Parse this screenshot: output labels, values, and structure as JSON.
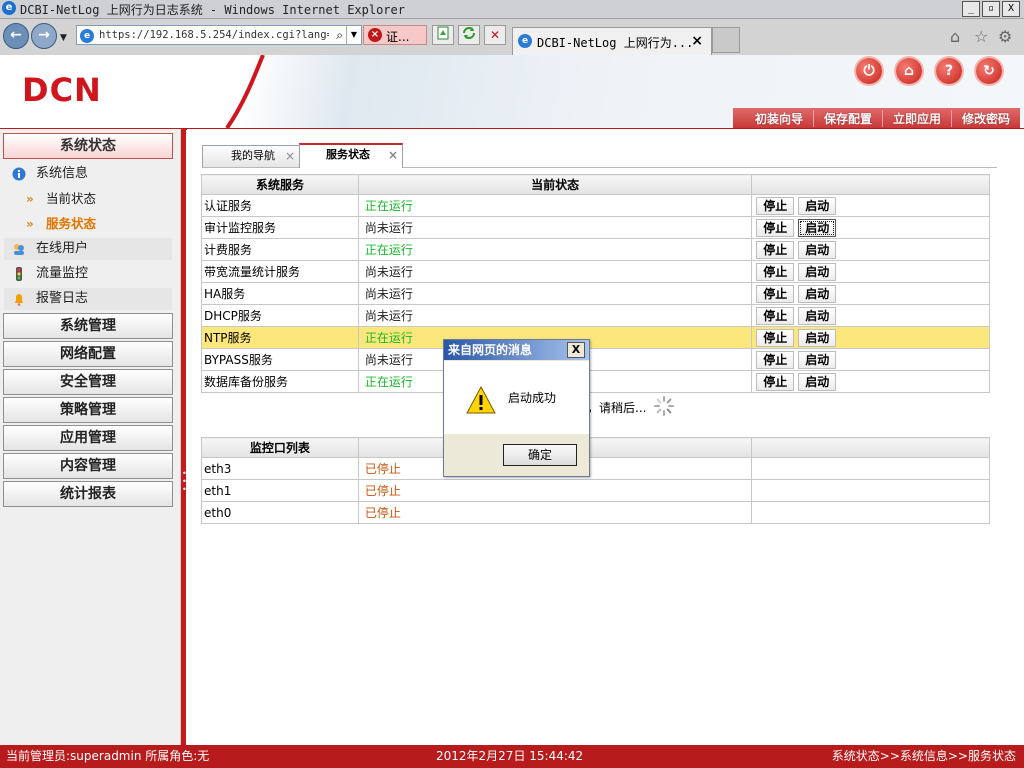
{
  "window": {
    "title": "DCBI-NetLog 上网行为日志系统 - Windows Internet Explorer",
    "min": "_",
    "max": "▫",
    "close": "X"
  },
  "browser": {
    "url": "https://192.168.5.254/index.cgi?lang=z",
    "cert_error_label": "证...",
    "tab_title": "DCBI-NetLog 上网行为...",
    "tab_close": "×"
  },
  "header": {
    "logo": "DCN",
    "menu": [
      "初装向导",
      "保存配置",
      "立即应用",
      "修改密码"
    ],
    "icons": [
      "power-icon",
      "home-icon",
      "help-icon",
      "refresh-icon"
    ]
  },
  "sidebar": {
    "status_section": "系统状态",
    "system_info": "系统信息",
    "sub_items": [
      {
        "label": "当前状态",
        "active": false
      },
      {
        "label": "服务状态",
        "active": true
      }
    ],
    "online_users": "在线用户",
    "traffic_monitor": "流量监控",
    "alarm_log": "报警日志",
    "sections": [
      "系统管理",
      "网络配置",
      "安全管理",
      "策略管理",
      "应用管理",
      "内容管理",
      "统计报表"
    ]
  },
  "content_tabs": [
    {
      "label": "我的导航",
      "close": "×",
      "active": false
    },
    {
      "label": "服务状态",
      "close": "×",
      "active": true
    }
  ],
  "services_table": {
    "headers": [
      "系统服务",
      "当前状态",
      ""
    ],
    "stop_label": "停止",
    "start_label": "启动",
    "rows": [
      {
        "name": "认证服务",
        "status": "正在运行",
        "running": true
      },
      {
        "name": "审计监控服务",
        "status": "尚未运行",
        "running": false
      },
      {
        "name": "计费服务",
        "status": "正在运行",
        "running": true
      },
      {
        "name": "带宽流量统计服务",
        "status": "尚未运行",
        "running": false
      },
      {
        "name": "HA服务",
        "status": "尚未运行",
        "running": false
      },
      {
        "name": "DHCP服务",
        "status": "尚未运行",
        "running": false
      },
      {
        "name": "NTP服务",
        "status": "正在运行",
        "running": true
      },
      {
        "name": "BYPASS服务",
        "status": "尚未运行",
        "running": false
      },
      {
        "name": "数据库备份服务",
        "status": "正在运行",
        "running": true
      }
    ]
  },
  "waiting_text": "，请稍后...",
  "interfaces_table": {
    "headers": [
      "监控口列表",
      "",
      ""
    ],
    "rows": [
      {
        "name": "eth3",
        "status": "已停止"
      },
      {
        "name": "eth1",
        "status": "已停止"
      },
      {
        "name": "eth0",
        "status": "已停止"
      }
    ]
  },
  "dialog": {
    "title": "来自网页的消息",
    "message": "启动成功",
    "ok": "确定",
    "close": "X"
  },
  "statusbar": {
    "left": "当前管理员:superadmin  所属角色:无",
    "center": "2012年2月27日 15:44:42",
    "right": "系统状态>>系统信息>>服务状态"
  },
  "colors": {
    "brand_red": "#b71b1b",
    "running_green": "#19b82a",
    "stopped_orange": "#c8570c",
    "highlight_row": "#fbe77b"
  }
}
